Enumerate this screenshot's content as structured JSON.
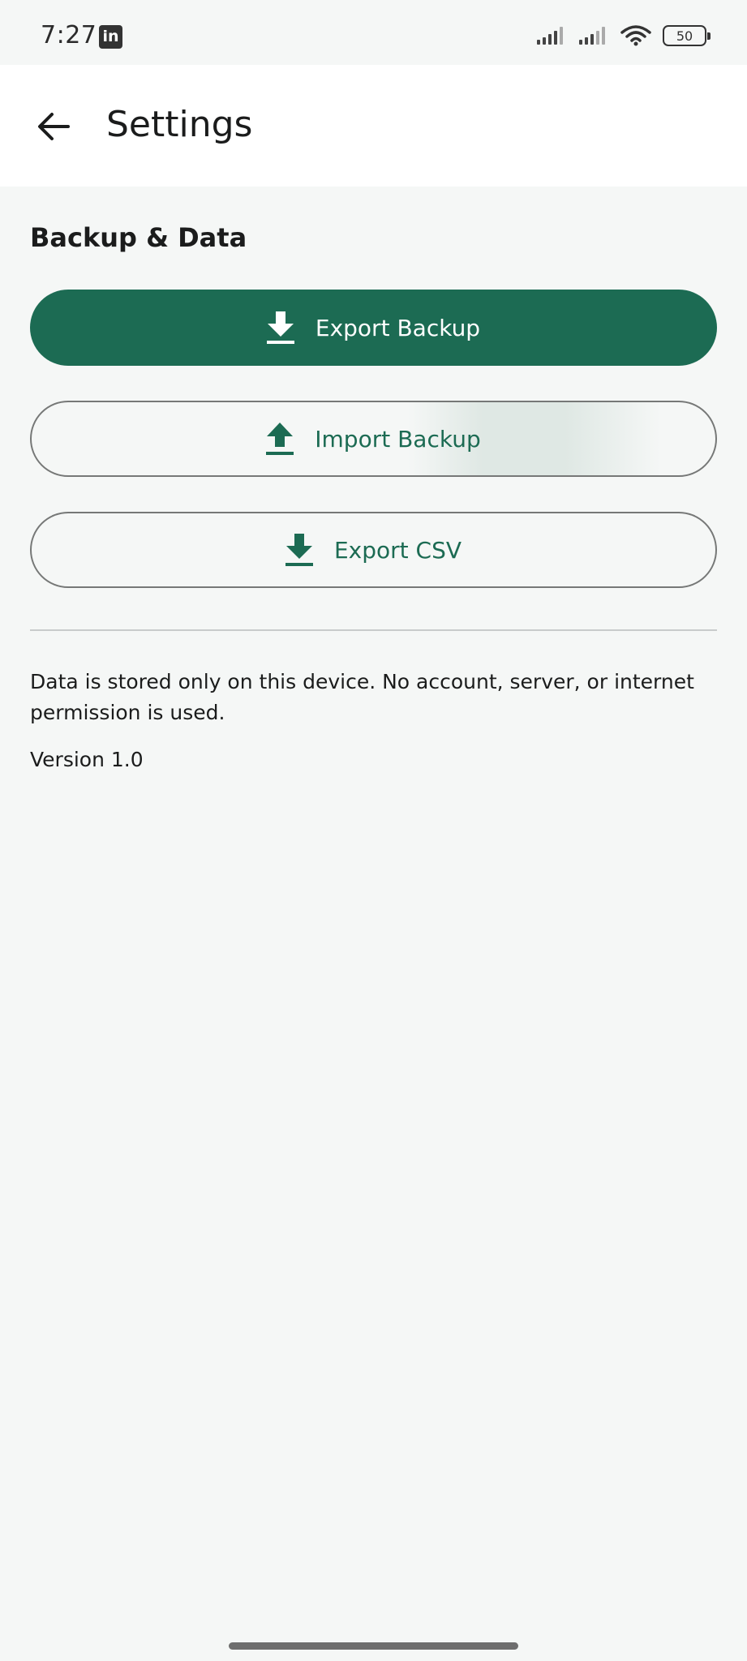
{
  "status_bar": {
    "time": "7:27",
    "notification_icon": "linkedin-icon",
    "battery_level": "50",
    "icons": [
      "signal-icon",
      "signal-icon",
      "wifi-icon",
      "battery-icon"
    ]
  },
  "app_bar": {
    "back_icon": "arrow-left-icon",
    "title": "Settings"
  },
  "section": {
    "title": "Backup & Data"
  },
  "buttons": {
    "export_backup": {
      "label": "Export Backup",
      "icon": "download-icon"
    },
    "import_backup": {
      "label": "Import Backup",
      "icon": "upload-icon"
    },
    "export_csv": {
      "label": "Export CSV",
      "icon": "download-icon"
    }
  },
  "info": {
    "text": "Data is stored only on this device. No account, server, or internet permission is used.",
    "version": "Version 1.0"
  },
  "colors": {
    "primary": "#1c6b53",
    "background": "#f5f7f6",
    "surface": "#ffffff",
    "outline": "#767877",
    "text": "#1b1c1c"
  }
}
